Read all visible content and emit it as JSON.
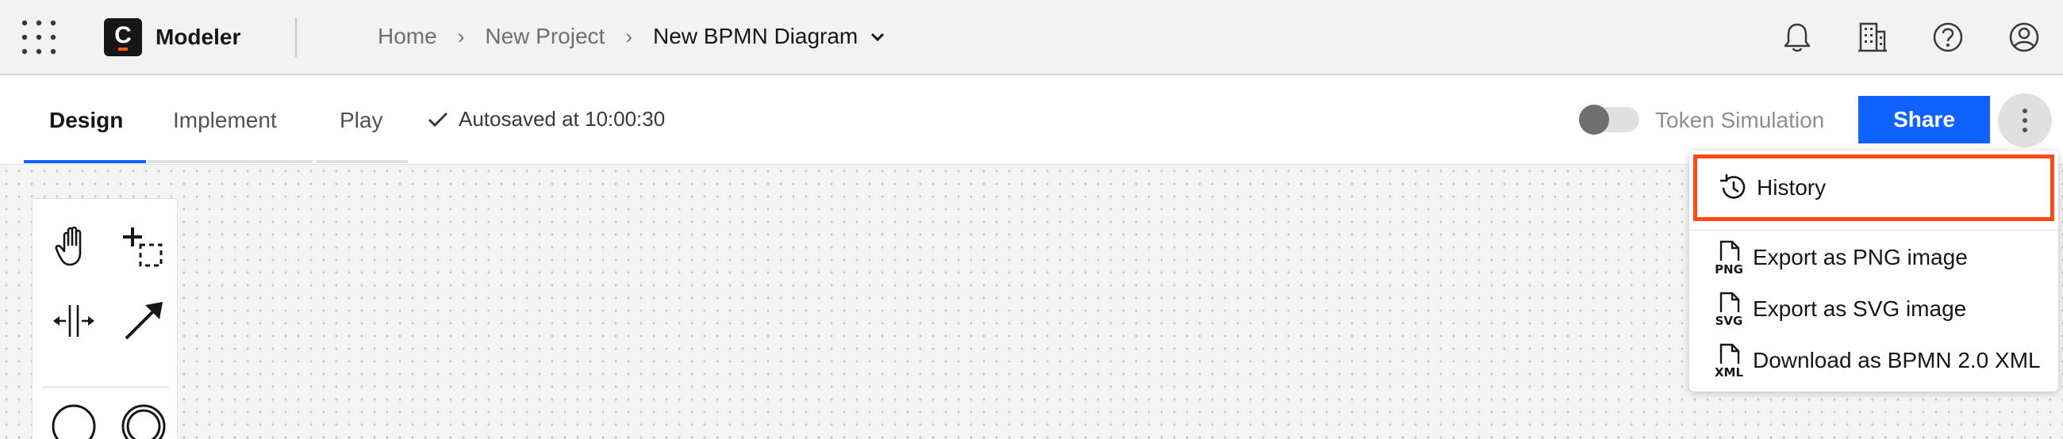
{
  "header": {
    "app_name": "Modeler",
    "logo_letter": "C",
    "breadcrumbs": [
      "Home",
      "New Project"
    ],
    "breadcrumb_separator": "›",
    "current": "New BPMN Diagram",
    "icons": [
      "app-switcher-icon",
      "bell-icon",
      "organization-icon",
      "help-icon",
      "user-avatar-icon"
    ]
  },
  "toolbar": {
    "tabs": [
      {
        "label": "Design",
        "active": true
      },
      {
        "label": "Implement",
        "active": false
      },
      {
        "label": "Play",
        "active": false
      }
    ],
    "autosave": "Autosaved at 10:00:30",
    "token_simulation_label": "Token Simulation",
    "token_simulation_on": false,
    "share_label": "Share",
    "accent": "#0f62fe"
  },
  "menu": {
    "items": [
      {
        "label": "History",
        "icon": "history-icon",
        "highlighted": true
      },
      {
        "label": "Export as PNG image",
        "icon": "png-file-icon",
        "badge": "PNG"
      },
      {
        "label": "Export as SVG image",
        "icon": "svg-file-icon",
        "badge": "SVG"
      },
      {
        "label": "Download as BPMN 2.0 XML",
        "icon": "xml-file-icon",
        "badge": "XML"
      }
    ],
    "highlight_color": "#fc4b13"
  },
  "palette": {
    "tools": [
      "hand-tool-icon",
      "lasso-tool-icon",
      "space-tool-icon",
      "connect-tool-icon",
      "start-event-icon",
      "intermediate-event-icon"
    ]
  }
}
